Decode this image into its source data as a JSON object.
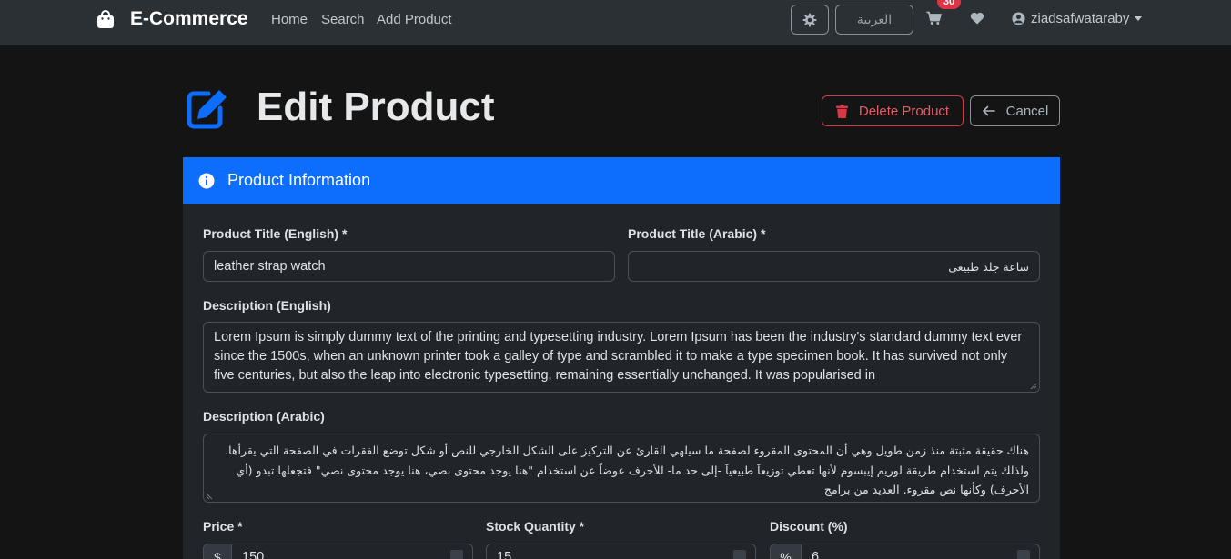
{
  "navbar": {
    "brand": "E-Commerce",
    "links": [
      "Home",
      "Search",
      "Add Product"
    ],
    "language_button": "العربية",
    "cart_count": "30",
    "username": "ziadsafwataraby"
  },
  "page": {
    "title": "Edit Product",
    "delete_label": "Delete Product",
    "cancel_label": "Cancel"
  },
  "card": {
    "title": "Product Information"
  },
  "form": {
    "title_en_label": "Product Title (English) *",
    "title_en_value": "leather  strap watch",
    "title_ar_label": "Product Title (Arabic) *",
    "title_ar_value": "ساعة جلد طبيعى",
    "desc_en_label": "Description (English)",
    "desc_en_value": "Lorem Ipsum is simply dummy text of the printing and typesetting industry. Lorem Ipsum has been the industry's standard dummy text ever since the 1500s, when an unknown printer took a galley of type and scrambled it to make a type specimen book. It has survived not only five centuries, but also the leap into electronic typesetting, remaining essentially unchanged. It was popularised in",
    "desc_ar_label": "Description (Arabic)",
    "desc_ar_value": "هناك حقيقة مثبتة منذ زمن طويل وهي أن المحتوى المقروء لصفحة ما سيلهي القارئ عن التركيز على الشكل الخارجي للنص أو شكل توضع الفقرات في الصفحة التي يقرأها. ولذلك يتم استخدام طريقة لوريم إيبسوم لأنها تعطي توزيعاَ طبيعياَ -إلى حد ما- للأحرف عوضاً عن استخدام \"هنا يوجد محتوى نصي، هنا يوجد محتوى نصي\" فتجعلها تبدو (أي الأحرف) وكأنها نص مقروء. العديد من برامج",
    "price_label": "Price *",
    "price_prefix": "$",
    "price_value": "150",
    "stock_label": "Stock Quantity *",
    "stock_value": "15",
    "discount_label": "Discount (%)",
    "discount_prefix": "%",
    "discount_value": "6"
  },
  "colors": {
    "primary": "#0d6efd",
    "danger": "#dc3545",
    "navbar_bg": "#2b3035",
    "page_bg": "#141414"
  }
}
